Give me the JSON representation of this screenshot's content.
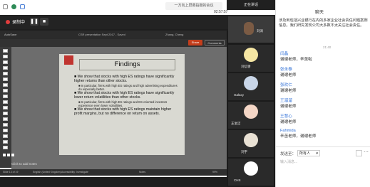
{
  "top": {
    "left_tabs": [
      "一方向上屏幕拍摄的会议",
      "正在讲话"
    ],
    "center_title": "正在讲话者主讲链接",
    "time": "02:57:57",
    "view_button": "演讲者视图"
  },
  "meeting": {
    "recording_label": "录制中",
    "pause_icon": "pause-icon",
    "stop_icon": "stop-icon"
  },
  "ppt": {
    "title": "CSR presentation Sept 2017 - Saved",
    "user": "Zhang, Cheng",
    "ribbon": [
      "File",
      "Home",
      "Insert",
      "Design",
      "Transitions",
      "Animations",
      "Slide Show",
      "Review",
      "View",
      "Help",
      "CSP Capital IQ",
      "Refinitiv Eikon"
    ],
    "share": "Share",
    "comments": "Comments",
    "slide_title": "Findings",
    "bullets": [
      {
        "text": "We show that stocks with high ES ratings have significantly higher returns than other stocks.",
        "sub": "In particular, firms with high ES ratings and high advertising expenditures do especially better."
      },
      {
        "text": "We show that stocks with high ES ratings have significantly lower return volatilities than other stocks.",
        "sub": "In particular, firms with high ES ratings and ES-oriented investors experience even lower volatilities."
      },
      {
        "text": "We show that stocks with high ES ratings maintain higher profit margins, but no difference on return on assets.",
        "sub": ""
      }
    ],
    "notes": "Click to add notes",
    "status_left": "Slide 13 of 19",
    "status_lang": "English (United Kingdom)",
    "status_access": "Accessibility: Investigate",
    "status_notes": "Notes",
    "status_zoom": "99%"
  },
  "participants": [
    {
      "name": "刘涛",
      "type": "video"
    },
    {
      "name": "刘信害",
      "type": "avatar"
    },
    {
      "name": "Galaxy",
      "type": "avatar"
    },
    {
      "name": "王溢洁",
      "type": "avatar"
    },
    {
      "name": "刘宇",
      "type": "avatar"
    },
    {
      "name": "CHS",
      "type": "avatar"
    }
  ],
  "chat": {
    "header": "聊天",
    "intro": "涉及到包括兴业银行在内的多家企业社会责任问题案例信息。我们研究发现公司大多数不太关注社会责任。",
    "time": "21:40",
    "messages": [
      {
        "name": "闫晶",
        "text": "谢谢老师，辛苦啦"
      },
      {
        "name": "张永泰",
        "text": "谢谢老师"
      },
      {
        "name": "张欢仁",
        "text": "谢谢老师"
      },
      {
        "name": "王溜溜",
        "text": "谢谢老师"
      },
      {
        "name": "王慧心",
        "text": "谢谢老师"
      },
      {
        "name": "Fahmida",
        "text": "辛苦老师，谢谢老师"
      }
    ],
    "send_to_label": "发送至：",
    "send_to_value": "所有人",
    "input_placeholder": "输入消息..."
  }
}
